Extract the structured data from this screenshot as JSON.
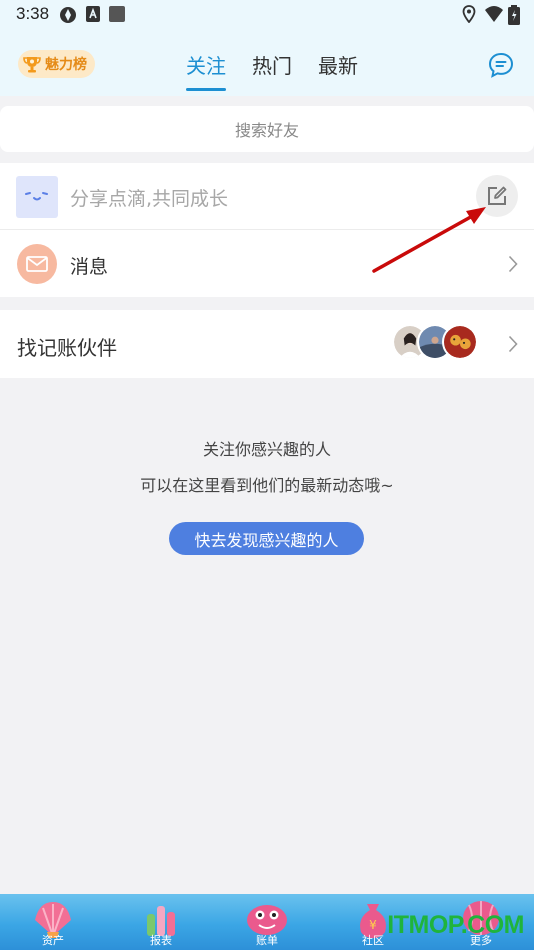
{
  "status_bar": {
    "time": "3:38"
  },
  "header": {
    "rank_label": "魅力榜",
    "tabs": [
      {
        "label": "关注",
        "active": true
      },
      {
        "label": "热门",
        "active": false
      },
      {
        "label": "最新",
        "active": false
      }
    ]
  },
  "search": {
    "placeholder": "搜索好友"
  },
  "post": {
    "placeholder": "分享点滴,共同成长"
  },
  "message": {
    "label": "消息"
  },
  "partners": {
    "label": "找记账伙伴"
  },
  "empty_state": {
    "title": "关注你感兴趣的人",
    "subtitle": "可以在这里看到他们的最新动态哦~",
    "button": "快去发现感兴趣的人"
  },
  "bottom_nav": [
    {
      "label": "资产",
      "icon": "shell-icon"
    },
    {
      "label": "报表",
      "icon": "coral-icon"
    },
    {
      "label": "账单",
      "icon": "octopus-icon"
    },
    {
      "label": "社区",
      "icon": "money-bag-icon"
    },
    {
      "label": "更多",
      "icon": "balloon-icon"
    }
  ],
  "watermark": "ITMOP.COM",
  "colors": {
    "accent": "#1d8fd2",
    "button": "#4e7fe0",
    "header_bg": "#ebf8fd"
  }
}
